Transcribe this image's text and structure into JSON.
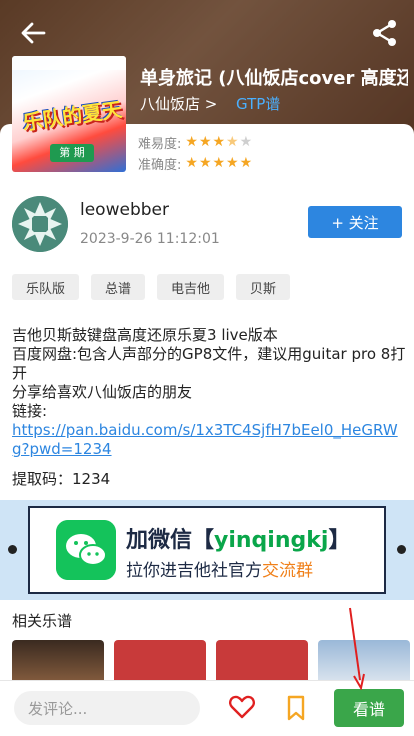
{
  "header": {
    "back_icon": "arrow-left-icon",
    "share_icon": "share-icon"
  },
  "song": {
    "title": "单身旅记 (八仙饭店cover 高度还原",
    "artist": "八仙饭店 >",
    "tab_type": "GTP谱"
  },
  "ratings": {
    "difficulty_label": "难易度:",
    "difficulty_stars": "★★★½☆",
    "difficulty_value": 3.5,
    "accuracy_label": "准确度:",
    "accuracy_stars": "★★★★★",
    "accuracy_value": 5
  },
  "author": {
    "name": "leowebber",
    "datetime": "2023-9-26 11:12:01",
    "follow_label": "+  关注"
  },
  "tags": [
    "乐队版",
    "总谱",
    "电吉他",
    "贝斯"
  ],
  "description": {
    "line1": "吉他贝斯鼓键盘高度还原乐夏3 live版本",
    "line2": "百度网盘:包含人声部分的GP8文件，建议用guitar pro 8打开",
    "line3": "分享给喜欢八仙饭店的朋友",
    "line4": "链接:",
    "link": "https://pan.baidu.com/s/1x3TC4SjfH7bEel0_HeGRWg?pwd=1234",
    "code": "提取码：1234"
  },
  "banner": {
    "line1_prefix": "加微信【",
    "line1_highlight": "yinqingkj",
    "line1_suffix": "】",
    "line2_prefix": "拉你进吉他社官方",
    "line2_highlight": "交流群",
    "colors": {
      "green": "#0aa64a",
      "orange": "#f0801a",
      "navy": "#1d2a44"
    }
  },
  "related": {
    "title": "相关乐谱"
  },
  "bottom": {
    "comment_placeholder": "发评论...",
    "view_label": "看谱"
  }
}
